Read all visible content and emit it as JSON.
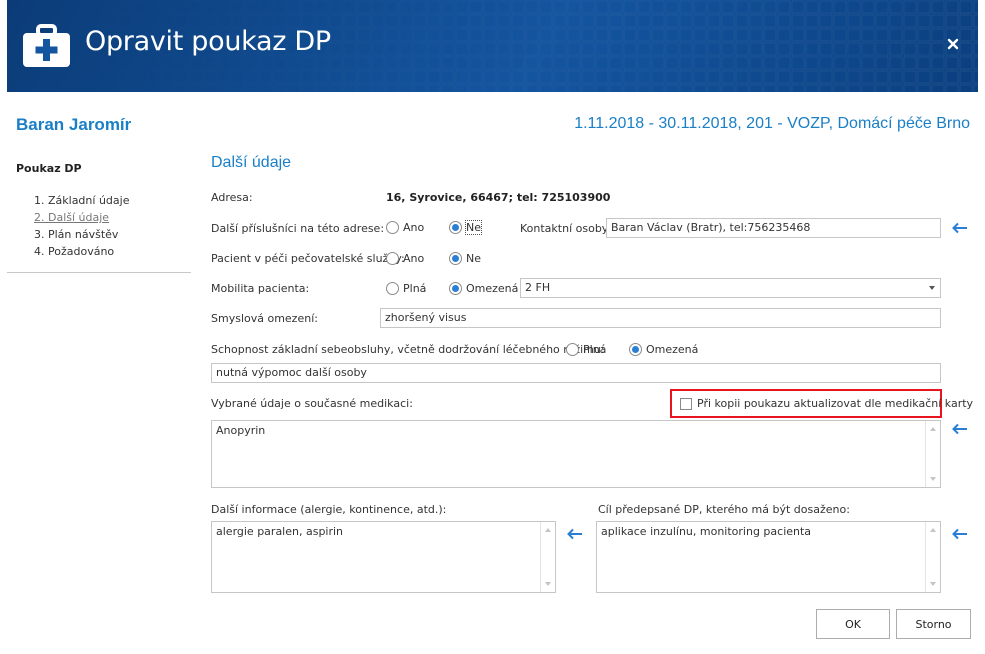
{
  "dialog": {
    "title": "Opravit poukaz DP",
    "brand_color": "#0f4a8e",
    "app_icon": "medical-kit-icon",
    "close_icon": "close-icon"
  },
  "patient": {
    "name": "Baran Jaromír",
    "period": "1.11.2018 - 30.11.2018, 201 - VOZP, Domácí péče Brno"
  },
  "nav": {
    "title": "Poukaz DP",
    "items": [
      {
        "label": "1. Základní údaje",
        "active": false
      },
      {
        "label": "2. Další údaje",
        "active": true
      },
      {
        "label": "3. Plán návštěv",
        "active": false
      },
      {
        "label": "4. Požadováno",
        "active": false
      }
    ]
  },
  "section": {
    "title": "Další údaje"
  },
  "form": {
    "address": {
      "label": "Adresa:",
      "value": "16, Syrovice, 66467; tel: 725103900"
    },
    "relatives": {
      "label": "Další příslušníci na této adrese:",
      "options": [
        "Ano",
        "Ne"
      ],
      "selected": "Ne",
      "contact_label": "Kontaktní osoby:",
      "contact_value": "Baran Václav (Bratr), tel:756235468"
    },
    "care_service": {
      "label": "Pacient v péči pečovatelské služby:",
      "options": [
        "Ano",
        "Ne"
      ],
      "selected": "Ne"
    },
    "mobility": {
      "label": "Mobilita pacienta:",
      "options": [
        "Plná",
        "Omezená"
      ],
      "selected": "Omezená",
      "select_value": "2 FH"
    },
    "sensory": {
      "label": "Smyslová omezení:",
      "value": "zhoršený visus"
    },
    "self_care": {
      "label": "Schopnost základní sebeobsluhy, včetně dodržování léčebného režimu:",
      "options": [
        "Plná",
        "Omezená"
      ],
      "selected": "Omezená",
      "value": "nutná výpomoc další osoby"
    },
    "medication": {
      "label": "Vybrané údaje o současné medikaci:",
      "checkbox_label": "Při kopii poukazu aktualizovat dle medikační karty",
      "checkbox_checked": false,
      "value": "Anopyrin"
    },
    "other_info": {
      "label": "Další informace (alergie, kontinence, atd.):",
      "value": "alergie paralen, aspirin"
    },
    "goal": {
      "label": "Cíl předepsané DP, kterého má být dosaženo:",
      "value": "aplikace inzulínu, monitoring pacienta"
    },
    "accent_color": "#2a7fd4",
    "highlight_color": "#e8141e",
    "arrow_icon": "arrow-left-icon"
  },
  "buttons": {
    "ok": "OK",
    "cancel": "Storno"
  }
}
